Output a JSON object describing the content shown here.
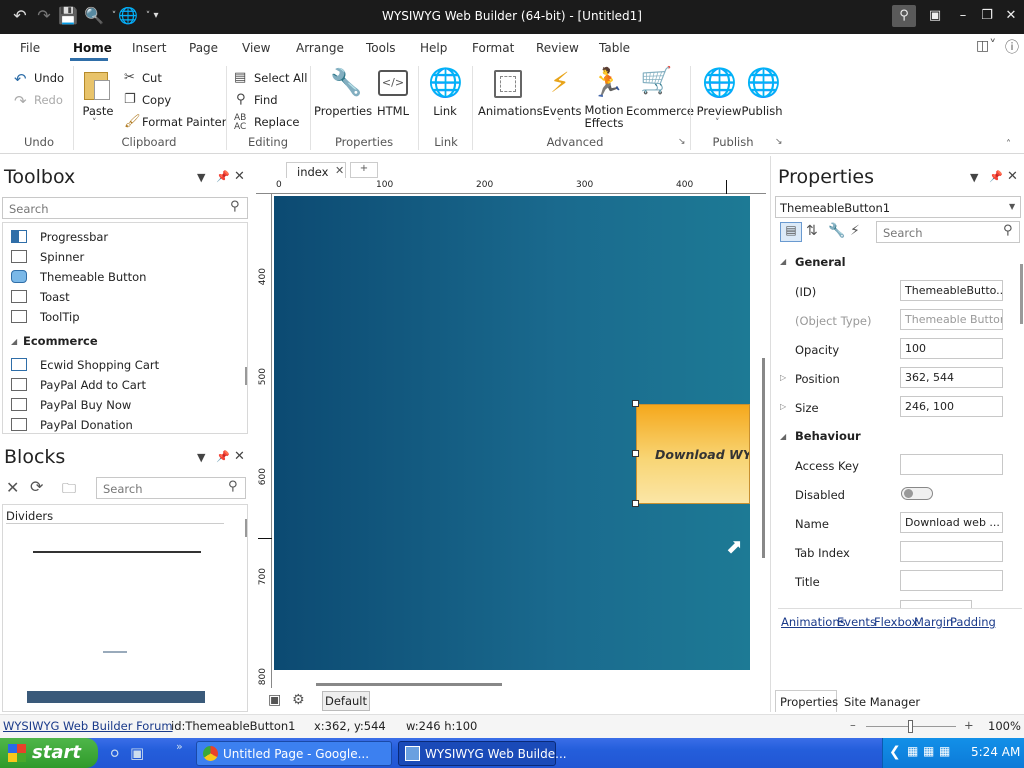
{
  "window": {
    "title": "WYSIWYG Web Builder (64-bit) - [Untitled1]"
  },
  "menu": {
    "tabs": [
      "File",
      "Home",
      "Insert",
      "Page",
      "View",
      "Arrange",
      "Tools",
      "Help",
      "Format",
      "Review",
      "Table"
    ],
    "active": "Home"
  },
  "ribbon": {
    "undo": "Undo",
    "redo": "Redo",
    "paste": "Paste",
    "cut": "Cut",
    "copy": "Copy",
    "format_painter": "Format Painter",
    "select_all": "Select All",
    "find": "Find",
    "replace": "Replace",
    "properties": "Properties",
    "html": "HTML",
    "link": "Link",
    "animations": "Animations",
    "events": "Events",
    "motion_effects": "Motion Effects",
    "ecommerce": "Ecommerce",
    "preview": "Preview",
    "publish": "Publish",
    "groups": {
      "undo": "Undo",
      "clipboard": "Clipboard",
      "editing": "Editing",
      "properties": "Properties",
      "link": "Link",
      "advanced": "Advanced",
      "publish": "Publish"
    }
  },
  "toolbox": {
    "title": "Toolbox",
    "search_placeholder": "Search",
    "items": [
      {
        "label": "Progressbar",
        "icon": "progressbar-icon"
      },
      {
        "label": "Spinner",
        "icon": "spinner-icon"
      },
      {
        "label": "Themeable Button",
        "icon": "button-icon"
      },
      {
        "label": "Toast",
        "icon": "toast-icon"
      },
      {
        "label": "ToolTip",
        "icon": "tooltip-icon"
      }
    ],
    "category": "Ecommerce",
    "ecommerce_items": [
      {
        "label": "Ecwid Shopping Cart",
        "icon": "cart-icon"
      },
      {
        "label": "PayPal Add to Cart",
        "icon": "paypal-add-icon"
      },
      {
        "label": "PayPal Buy Now",
        "icon": "paypal-buy-icon"
      },
      {
        "label": "PayPal Donation",
        "icon": "paypal-donation-icon"
      }
    ]
  },
  "blocks": {
    "title": "Blocks",
    "search_placeholder": "Search",
    "category": "Dividers"
  },
  "document": {
    "tab": "index",
    "ruler_h": [
      "0",
      "100",
      "200",
      "300",
      "400"
    ],
    "ruler_v": [
      "400",
      "500",
      "600",
      "700",
      "800"
    ],
    "button_text": "Download WYS",
    "layer_label": "Default"
  },
  "properties": {
    "title": "Properties",
    "object_selector": "ThemeableButton1",
    "search_placeholder": "Search",
    "general": "General",
    "behaviour": "Behaviour",
    "rows_general": [
      {
        "key": "(ID)",
        "value": "ThemeableButto..."
      },
      {
        "key": "(Object Type)",
        "value": "Themeable Button"
      },
      {
        "key": "Opacity",
        "value": "100"
      },
      {
        "key": "Position",
        "value": "362, 544"
      },
      {
        "key": "Size",
        "value": "246, 100"
      }
    ],
    "rows_behaviour": [
      {
        "key": "Access Key",
        "value": ""
      },
      {
        "key": "Disabled",
        "value": ""
      },
      {
        "key": "Name",
        "value": "Download web ..."
      },
      {
        "key": "Tab Index",
        "value": ""
      },
      {
        "key": "Title",
        "value": ""
      }
    ],
    "links": [
      "Animations",
      "Events",
      "Flexbox",
      "Margin",
      "Padding"
    ],
    "bottom_tabs": [
      "Properties",
      "Site Manager"
    ]
  },
  "status": {
    "forum_link": "WYSIWYG Web Builder Forum",
    "id": "id:ThemeableButton1",
    "pos": "x:362, y:544",
    "size": "w:246 h:100",
    "zoom": "100%"
  },
  "taskbar": {
    "start": "start",
    "tasks": [
      "Untitled Page - Google...",
      "WYSIWYG Web Builde..."
    ],
    "clock": "5:24 AM"
  }
}
